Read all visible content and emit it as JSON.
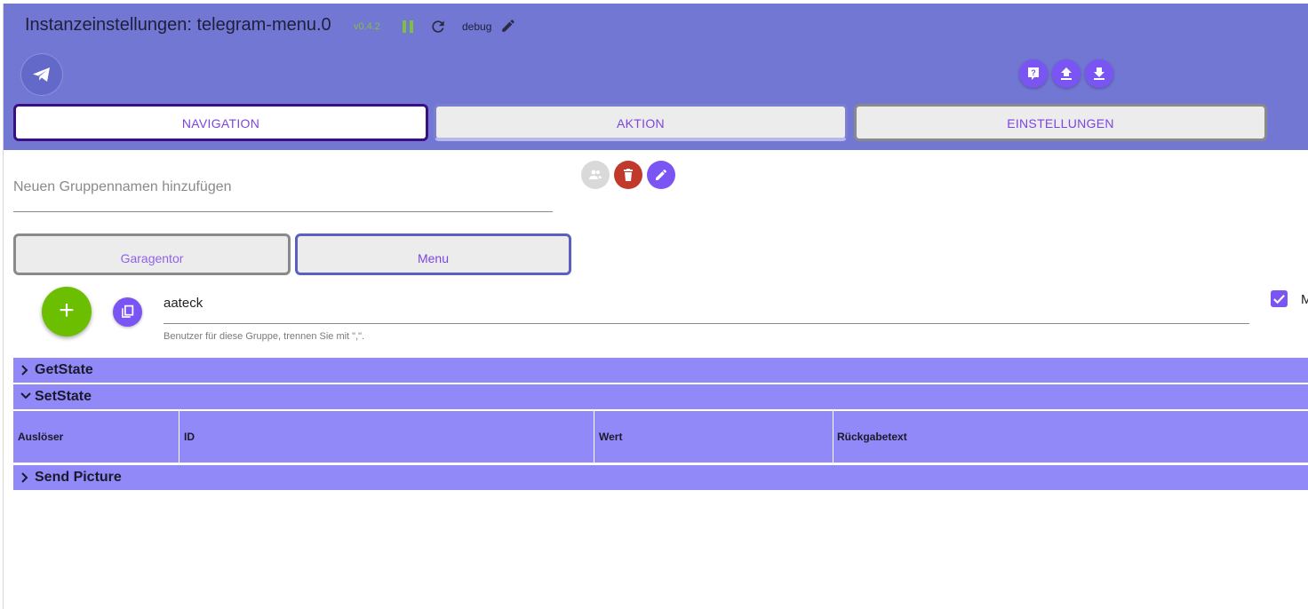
{
  "window": {
    "title": "Instanzeinstellungen: telegram-menu.0",
    "version": "v0.4.2",
    "log_level": "debug"
  },
  "header": {
    "icons": [
      "help-icon",
      "upload-icon",
      "download-icon"
    ]
  },
  "tabs": [
    {
      "label": "NAVIGATION",
      "active": true
    },
    {
      "label": "AKTION",
      "active": false
    },
    {
      "label": "EINSTELLUNGEN",
      "active": false
    }
  ],
  "group": {
    "new_group_placeholder": "Neuen Gruppennamen hinzufügen",
    "groups": [
      {
        "label": "Garagentor",
        "selected": false
      },
      {
        "label": "Menu",
        "selected": true
      }
    ],
    "users_value": "aateck",
    "users_hint": "Benutzer für diese Gruppe, trennen Sie mit \",\".",
    "checkbox_label_partial": "M",
    "checkbox_checked": true
  },
  "sections": {
    "getstate": "GetState",
    "setstate": "SetState",
    "sendpicture": "Send Picture"
  },
  "table": {
    "columns": [
      "Auslöser",
      "ID",
      "Wert",
      "Rückgabetext"
    ]
  },
  "colors": {
    "header_bg": "#7277d4",
    "accent": "#7a55f3",
    "section_bg": "#9189f8",
    "add_green": "#6cbf00",
    "delete_red": "#c0392b"
  }
}
